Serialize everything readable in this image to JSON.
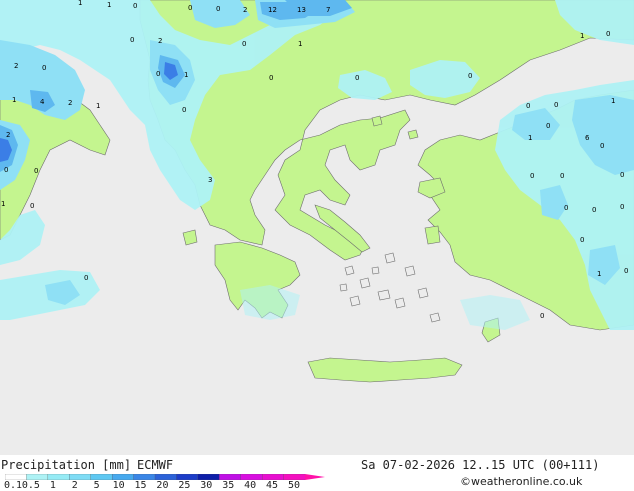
{
  "map": {
    "colors": {
      "sea": "#ececec",
      "land_dry": "#c4f58f",
      "precip_light": "#aef2f5",
      "precip_mid": "#8fe0f5",
      "precip_heavy": "#5eb8ef",
      "precip_very_heavy": "#3b7ee6",
      "coast": "#6e6e6e"
    },
    "values": [
      {
        "id": "v1",
        "text": "1"
      },
      {
        "id": "v2",
        "text": "1"
      },
      {
        "id": "v3",
        "text": "0"
      },
      {
        "id": "v4",
        "text": "0"
      },
      {
        "id": "v5",
        "text": "0"
      },
      {
        "id": "v6",
        "text": "2"
      },
      {
        "id": "v7",
        "text": "12"
      },
      {
        "id": "v8",
        "text": "13"
      },
      {
        "id": "v9",
        "text": "7"
      },
      {
        "id": "v10",
        "text": "0"
      },
      {
        "id": "v11",
        "text": "2"
      },
      {
        "id": "v12",
        "text": "1"
      },
      {
        "id": "v13",
        "text": "0"
      },
      {
        "id": "v14",
        "text": "1"
      },
      {
        "id": "v15",
        "text": "2"
      },
      {
        "id": "v16",
        "text": "0"
      },
      {
        "id": "v17",
        "text": "0"
      },
      {
        "id": "v18",
        "text": "1"
      },
      {
        "id": "v19",
        "text": "0"
      },
      {
        "id": "v20",
        "text": "0"
      },
      {
        "id": "v21",
        "text": "1"
      },
      {
        "id": "v22",
        "text": "4"
      },
      {
        "id": "v23",
        "text": "2"
      },
      {
        "id": "v24",
        "text": "1"
      },
      {
        "id": "v25",
        "text": "0"
      },
      {
        "id": "v26",
        "text": "0"
      },
      {
        "id": "v27",
        "text": "0"
      },
      {
        "id": "v28",
        "text": "0"
      },
      {
        "id": "v29",
        "text": "1"
      },
      {
        "id": "v30",
        "text": "0"
      },
      {
        "id": "v31",
        "text": "0"
      },
      {
        "id": "v32",
        "text": "6"
      },
      {
        "id": "v33",
        "text": "2"
      },
      {
        "id": "v34",
        "text": "0"
      },
      {
        "id": "v35",
        "text": "0"
      },
      {
        "id": "v36",
        "text": "3"
      },
      {
        "id": "v37",
        "text": "1"
      },
      {
        "id": "v38",
        "text": "0"
      },
      {
        "id": "v39",
        "text": "0"
      },
      {
        "id": "v40",
        "text": "0"
      },
      {
        "id": "v41",
        "text": "0"
      },
      {
        "id": "v42",
        "text": "0"
      },
      {
        "id": "v43",
        "text": "0"
      },
      {
        "id": "v44",
        "text": "0"
      },
      {
        "id": "v45",
        "text": "0"
      },
      {
        "id": "v46",
        "text": "1"
      },
      {
        "id": "v47",
        "text": "0"
      },
      {
        "id": "v48",
        "text": "1"
      },
      {
        "id": "v49",
        "text": "0"
      },
      {
        "id": "v50",
        "text": "0"
      },
      {
        "id": "v51",
        "text": "0"
      }
    ]
  },
  "footer": {
    "title": "Precipitation [mm]",
    "model": "ECMWF",
    "datetime": "Sa 07-02-2026 12..15 UTC (00+111)",
    "credit": "©weatheronline.co.uk"
  },
  "legend": {
    "ticks": [
      "0.1",
      "0.5",
      "1",
      "2",
      "5",
      "10",
      "15",
      "20",
      "25",
      "30",
      "35",
      "40",
      "45",
      "50"
    ],
    "colors": [
      "#ffffff",
      "#aef2f5",
      "#96ebf5",
      "#7fdcf5",
      "#5fc8f2",
      "#47a9ee",
      "#3a86e6",
      "#2c62d8",
      "#1d3dc8",
      "#0e1fa8",
      "#c010e6",
      "#d80fe0",
      "#e80fd0",
      "#f410c0",
      "#ff12a8"
    ]
  }
}
